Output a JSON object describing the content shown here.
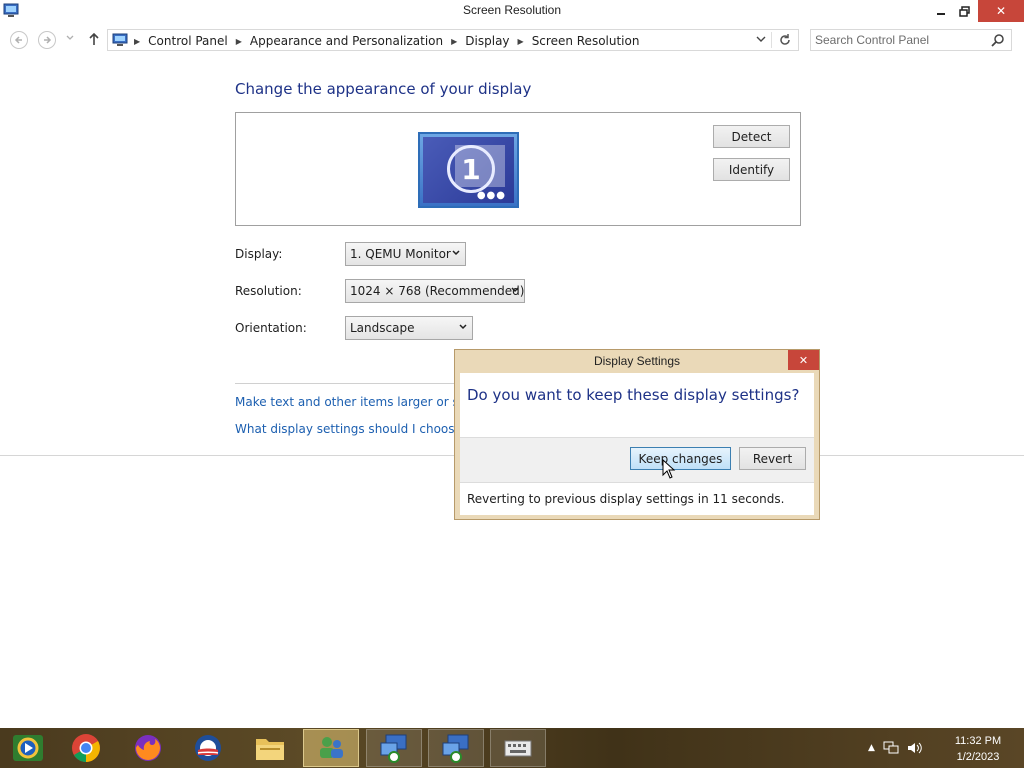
{
  "window": {
    "title": "Screen Resolution",
    "close_glyph": "✕"
  },
  "breadcrumb": [
    "Control Panel",
    "Appearance and Personalization",
    "Display",
    "Screen Resolution"
  ],
  "search": {
    "placeholder": "Search Control Panel"
  },
  "main": {
    "heading": "Change the appearance of your display",
    "monitor_number": "1",
    "detect_label": "Detect",
    "identify_label": "Identify",
    "display_label": "Display:",
    "display_value": "1. QEMU Monitor",
    "resolution_label": "Resolution:",
    "resolution_value": "1024 × 768 (Recommended)",
    "orientation_label": "Orientation:",
    "orientation_value": "Landscape",
    "link_text_size": "Make text and other items larger or sm",
    "link_display_help": "What display settings should I choose?"
  },
  "dialog": {
    "title": "Display Settings",
    "question": "Do you want to keep these display settings?",
    "keep_label": "Keep changes",
    "revert_label": "Revert",
    "status": "Reverting to previous display settings in 11 seconds."
  },
  "taskbar": {
    "items": [
      "media-player",
      "chrome",
      "firefox",
      "obama-campaign",
      "file-explorer",
      "control-panel",
      "remote-desktop",
      "remote-desktop",
      "keyboard-app"
    ],
    "time": "11:32 PM",
    "date": "1/2/2023"
  },
  "colors": {
    "heading_blue": "#1e3287",
    "link_blue": "#1c5fb0",
    "close_red": "#c7463a"
  }
}
